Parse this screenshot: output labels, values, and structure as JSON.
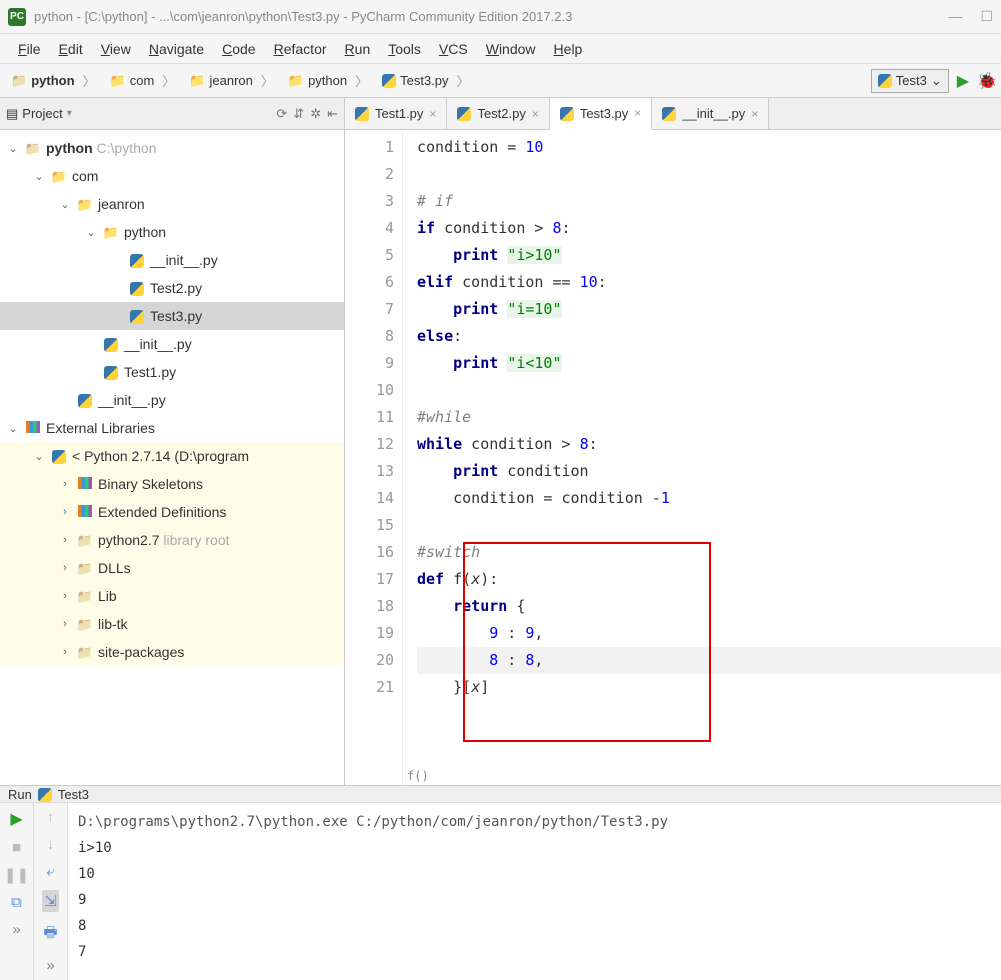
{
  "titlebar": {
    "app_icon_text": "PC",
    "title": "python - [C:\\python] - ...\\com\\jeanron\\python\\Test3.py - PyCharm Community Edition 2017.2.3",
    "minimize": "—",
    "maximize": "☐"
  },
  "menubar": {
    "items": [
      "File",
      "Edit",
      "View",
      "Navigate",
      "Code",
      "Refactor",
      "Run",
      "Tools",
      "VCS",
      "Window",
      "Help"
    ]
  },
  "breadcrumbs": {
    "items": [
      {
        "icon": "folder",
        "label": "python",
        "bold": true
      },
      {
        "icon": "pkg",
        "label": "com"
      },
      {
        "icon": "pkg",
        "label": "jeanron"
      },
      {
        "icon": "pkg",
        "label": "python"
      },
      {
        "icon": "py",
        "label": "Test3.py"
      }
    ]
  },
  "run_config": {
    "name": "Test3",
    "dropdown": "⌄"
  },
  "project_panel": {
    "title": "Project",
    "icons": [
      "⟳",
      "⇵",
      "✲",
      "⇤"
    ],
    "tree": [
      {
        "depth": 0,
        "expand": "down",
        "icon": "folder",
        "label": "python",
        "hint": "  C:\\python",
        "bold": true
      },
      {
        "depth": 1,
        "expand": "down",
        "icon": "pkg",
        "label": "com"
      },
      {
        "depth": 2,
        "expand": "down",
        "icon": "pkg",
        "label": "jeanron"
      },
      {
        "depth": 3,
        "expand": "down",
        "icon": "pkg",
        "label": "python"
      },
      {
        "depth": 4,
        "expand": "",
        "icon": "py",
        "label": "__init__.py"
      },
      {
        "depth": 4,
        "expand": "",
        "icon": "py",
        "label": "Test2.py"
      },
      {
        "depth": 4,
        "expand": "",
        "icon": "py",
        "label": "Test3.py",
        "selected": true
      },
      {
        "depth": 3,
        "expand": "",
        "icon": "py",
        "label": "__init__.py"
      },
      {
        "depth": 3,
        "expand": "",
        "icon": "py",
        "label": "Test1.py"
      },
      {
        "depth": 2,
        "expand": "",
        "icon": "py",
        "label": "__init__.py"
      },
      {
        "depth": 0,
        "expand": "down",
        "icon": "libs",
        "label": "External Libraries"
      },
      {
        "depth": 1,
        "expand": "down",
        "icon": "py",
        "label": "< Python 2.7.14 (D:\\program",
        "lib": true
      },
      {
        "depth": 2,
        "expand": "right",
        "icon": "libs",
        "label": "Binary Skeletons",
        "lib": true
      },
      {
        "depth": 2,
        "expand": "right",
        "icon": "libs",
        "label": "Extended Definitions",
        "lib": true
      },
      {
        "depth": 2,
        "expand": "right",
        "icon": "folder",
        "label": "python2.7",
        "hint": "  library root",
        "lib": true
      },
      {
        "depth": 2,
        "expand": "right",
        "icon": "folder",
        "label": "DLLs",
        "lib": true
      },
      {
        "depth": 2,
        "expand": "right",
        "icon": "folder",
        "label": "Lib",
        "lib": true
      },
      {
        "depth": 2,
        "expand": "right",
        "icon": "folder",
        "label": "lib-tk",
        "lib": true
      },
      {
        "depth": 2,
        "expand": "right",
        "icon": "folder",
        "label": "site-packages",
        "lib": true
      }
    ]
  },
  "tabs": [
    {
      "label": "Test1.py",
      "active": false
    },
    {
      "label": "Test2.py",
      "active": false
    },
    {
      "label": "Test3.py",
      "active": true
    },
    {
      "label": "__init__.py",
      "active": false
    }
  ],
  "code": {
    "lines": [
      {
        "n": 1,
        "tokens": [
          {
            "t": "condition = ",
            "c": ""
          },
          {
            "t": "10",
            "c": "num"
          }
        ]
      },
      {
        "n": 2,
        "tokens": []
      },
      {
        "n": 3,
        "tokens": [
          {
            "t": "# if",
            "c": "cmt"
          }
        ]
      },
      {
        "n": 4,
        "tokens": [
          {
            "t": "if",
            "c": "kw"
          },
          {
            "t": " condition > ",
            "c": ""
          },
          {
            "t": "8",
            "c": "num"
          },
          {
            "t": ":",
            "c": ""
          }
        ]
      },
      {
        "n": 5,
        "tokens": [
          {
            "t": "    ",
            "c": ""
          },
          {
            "t": "print",
            "c": "kw"
          },
          {
            "t": " ",
            "c": ""
          },
          {
            "t": "\"i>10\"",
            "c": "str"
          }
        ]
      },
      {
        "n": 6,
        "tokens": [
          {
            "t": "elif",
            "c": "kw"
          },
          {
            "t": " condition == ",
            "c": ""
          },
          {
            "t": "10",
            "c": "num"
          },
          {
            "t": ":",
            "c": ""
          }
        ]
      },
      {
        "n": 7,
        "tokens": [
          {
            "t": "    ",
            "c": ""
          },
          {
            "t": "print",
            "c": "kw"
          },
          {
            "t": " ",
            "c": ""
          },
          {
            "t": "\"i=10\"",
            "c": "str"
          }
        ]
      },
      {
        "n": 8,
        "tokens": [
          {
            "t": "else",
            "c": "kw"
          },
          {
            "t": ":",
            "c": ""
          }
        ]
      },
      {
        "n": 9,
        "tokens": [
          {
            "t": "    ",
            "c": ""
          },
          {
            "t": "print",
            "c": "kw"
          },
          {
            "t": " ",
            "c": ""
          },
          {
            "t": "\"i<10\"",
            "c": "str"
          }
        ]
      },
      {
        "n": 10,
        "tokens": []
      },
      {
        "n": 11,
        "tokens": [
          {
            "t": "#while",
            "c": "cmt"
          }
        ]
      },
      {
        "n": 12,
        "tokens": [
          {
            "t": "while",
            "c": "kw"
          },
          {
            "t": " condition > ",
            "c": ""
          },
          {
            "t": "8",
            "c": "num"
          },
          {
            "t": ":",
            "c": ""
          }
        ]
      },
      {
        "n": 13,
        "tokens": [
          {
            "t": "    ",
            "c": ""
          },
          {
            "t": "print",
            "c": "kw"
          },
          {
            "t": " condition",
            "c": ""
          }
        ]
      },
      {
        "n": 14,
        "tokens": [
          {
            "t": "    condition = condition -",
            "c": ""
          },
          {
            "t": "1",
            "c": "num"
          }
        ]
      },
      {
        "n": 15,
        "tokens": []
      },
      {
        "n": 16,
        "tokens": [
          {
            "t": "#switch",
            "c": "cmt"
          }
        ]
      },
      {
        "n": 17,
        "tokens": [
          {
            "t": "def",
            "c": "kw"
          },
          {
            "t": " f(",
            "c": ""
          },
          {
            "t": "x",
            "c": "ident"
          },
          {
            "t": "):",
            "c": ""
          }
        ]
      },
      {
        "n": 18,
        "tokens": [
          {
            "t": "    ",
            "c": ""
          },
          {
            "t": "return",
            "c": "kw"
          },
          {
            "t": " {",
            "c": ""
          }
        ]
      },
      {
        "n": 19,
        "tokens": [
          {
            "t": "        ",
            "c": ""
          },
          {
            "t": "9",
            "c": "num"
          },
          {
            "t": " : ",
            "c": ""
          },
          {
            "t": "9",
            "c": "num"
          },
          {
            "t": ",",
            "c": ""
          }
        ]
      },
      {
        "n": 20,
        "tokens": [
          {
            "t": "        ",
            "c": ""
          },
          {
            "t": "8",
            "c": "num"
          },
          {
            "t": " : ",
            "c": ""
          },
          {
            "t": "8",
            "c": "num"
          },
          {
            "t": ",",
            "c": ""
          }
        ],
        "hl": true
      },
      {
        "n": 21,
        "tokens": [
          {
            "t": "    }[",
            "c": ""
          },
          {
            "t": "x",
            "c": "ident"
          },
          {
            "t": "]",
            "c": ""
          }
        ]
      }
    ],
    "breadcrumb": "f()"
  },
  "run": {
    "tab_label": "Run",
    "config": "Test3",
    "output": [
      "D:\\programs\\python2.7\\python.exe C:/python/com/jeanron/python/Test3.py",
      "i>10",
      "10",
      "9",
      "8",
      "7"
    ],
    "left_more": "»",
    "right_more": "»"
  }
}
